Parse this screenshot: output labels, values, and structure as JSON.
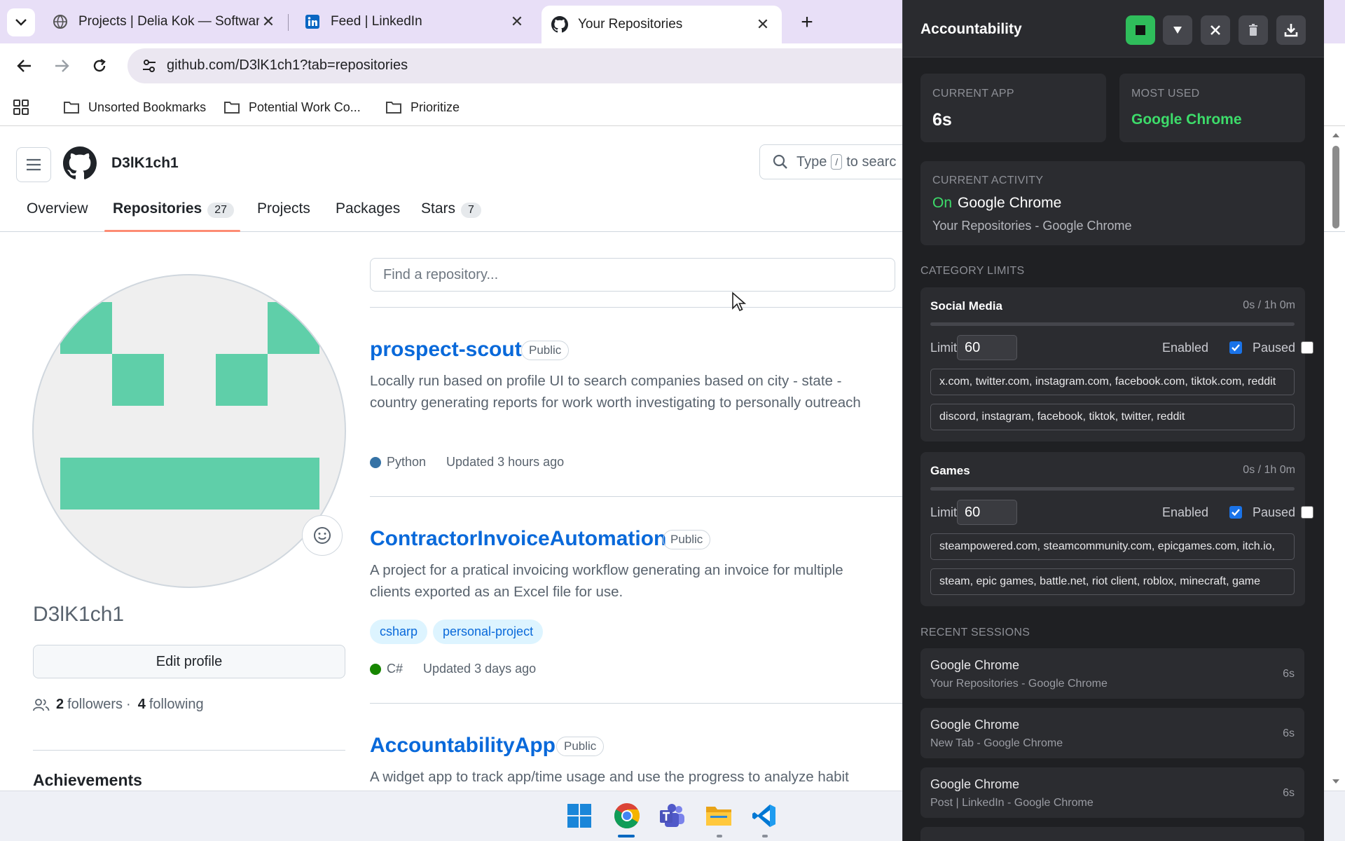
{
  "browser": {
    "tabs": [
      {
        "title": "Projects | Delia Kok — Software"
      },
      {
        "title": "Feed | LinkedIn"
      },
      {
        "title": "Your Repositories"
      }
    ],
    "url": "github.com/D3lK1ch1?tab=repositories",
    "bookmarks": [
      "Unsorted Bookmarks",
      "Potential Work Co...",
      "Prioritize"
    ]
  },
  "github": {
    "username": "D3lK1ch1",
    "search_placeholder_prefix": "Type",
    "search_slash": "/",
    "search_placeholder_suffix": "to searc",
    "tabs": [
      {
        "label": "Overview"
      },
      {
        "label": "Repositories",
        "count": "27"
      },
      {
        "label": "Projects"
      },
      {
        "label": "Packages"
      },
      {
        "label": "Stars",
        "count": "7"
      }
    ],
    "profile_name": "D3lK1ch1",
    "edit_profile": "Edit profile",
    "followers_count": "2",
    "followers_label": "followers",
    "separator": "·",
    "following_count": "4",
    "following_label": "following",
    "achievements": "Achievements",
    "find_repo_placeholder": "Find a repository...",
    "repos": [
      {
        "name": "prospect-scout",
        "visibility": "Public",
        "description": "Locally run based on profile UI to search companies based on city - state - country generating reports for work worth investigating to personally outreach",
        "language": "Python",
        "language_color": "#3572A5",
        "updated": "Updated 3 hours ago",
        "topics": []
      },
      {
        "name": "ContractorInvoiceAutomation",
        "visibility": "Public",
        "description": "A project for a pratical invoicing workflow generating an invoice for multiple clients exported as an Excel file for use.",
        "language": "C#",
        "language_color": "#178600",
        "updated": "Updated 3 days ago",
        "topics": [
          "csharp",
          "personal-project"
        ]
      },
      {
        "name": "AccountabilityApp",
        "visibility": "Public",
        "description": "A widget app to track app/time usage and use the progress to analyze habit"
      }
    ]
  },
  "widget": {
    "title": "Accountability",
    "current_app_label": "CURRENT APP",
    "current_app_value": "6s",
    "most_used_label": "MOST USED",
    "most_used_value": "Google Chrome",
    "current_activity_label": "CURRENT ACTIVITY",
    "activity_status": "On",
    "activity_app": "Google Chrome",
    "activity_title": "Your Repositories - Google Chrome",
    "category_limits_label": "CATEGORY LIMITS",
    "categories": [
      {
        "name": "Social Media",
        "usage": "0s / 1h 0m",
        "progress": 0,
        "limit_label": "Limit",
        "limit": "60",
        "enabled_label": "Enabled",
        "enabled": true,
        "paused_label": "Paused",
        "paused": false,
        "domains": "x.com, twitter.com, instagram.com, facebook.com, tiktok.com, reddit",
        "apps": "discord, instagram, facebook, tiktok, twitter, reddit"
      },
      {
        "name": "Games",
        "usage": "0s / 1h 0m",
        "progress": 0,
        "limit_label": "Limit",
        "limit": "60",
        "enabled_label": "Enabled",
        "enabled": true,
        "paused_label": "Paused",
        "paused": false,
        "domains": "steampowered.com, steamcommunity.com, epicgames.com, itch.io,",
        "apps": "steam, epic games, battle.net, riot client, roblox, minecraft, game"
      }
    ],
    "recent_sessions_label": "RECENT SESSIONS",
    "sessions": [
      {
        "app": "Google Chrome",
        "title": "Your Repositories - Google Chrome",
        "duration": "6s"
      },
      {
        "app": "Google Chrome",
        "title": "New Tab - Google Chrome",
        "duration": "6s"
      },
      {
        "app": "Google Chrome",
        "title": "Post | LinkedIn - Google Chrome",
        "duration": "6s"
      }
    ]
  },
  "colors": {
    "accent_green": "#3ddc6a",
    "link_blue": "#0969da",
    "avatar_teal": "#5fcfa9"
  }
}
